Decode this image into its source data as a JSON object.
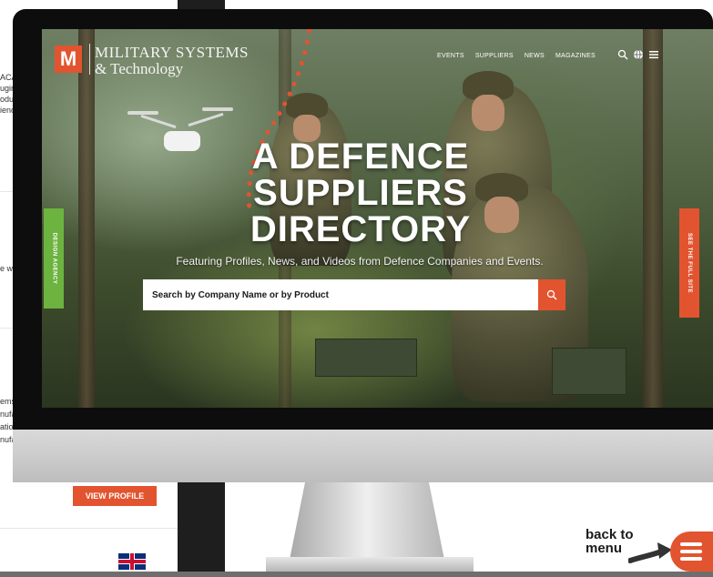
{
  "background_page": {
    "top_block_lines": [
      "ACAL",
      "ugin",
      "oduc",
      "ienc"
    ],
    "middle_line": "e wh",
    "lower_block_lines": [
      "ems",
      "nufa",
      "atio",
      "nufa"
    ],
    "button_label": "VIEW PROFILE"
  },
  "site": {
    "logo_letter": "M",
    "logo_line1": "MILITARY SYSTEMS",
    "logo_line2": "& Technology",
    "nav": [
      "EVENTS",
      "SUPPLIERS",
      "NEWS",
      "MAGAZINES"
    ],
    "nav_icons": [
      "search-icon",
      "globe-icon",
      "hamburger-icon"
    ],
    "hero_title_lines": [
      "A DEFENCE",
      "SUPPLIERS",
      "DIRECTORY"
    ],
    "subtitle": "Featuring Profiles, News, and Videos from Defence Companies and Events.",
    "search_placeholder": "Search by Company Name or by Product",
    "left_tab": "DESIGN AGENCY",
    "right_tab": "SEE THE FULL SITE"
  },
  "back_to_menu": {
    "line1": "back to",
    "line2": "menu"
  },
  "colors": {
    "brand_orange": "#e2542f",
    "tab_green": "#6cb33f"
  }
}
